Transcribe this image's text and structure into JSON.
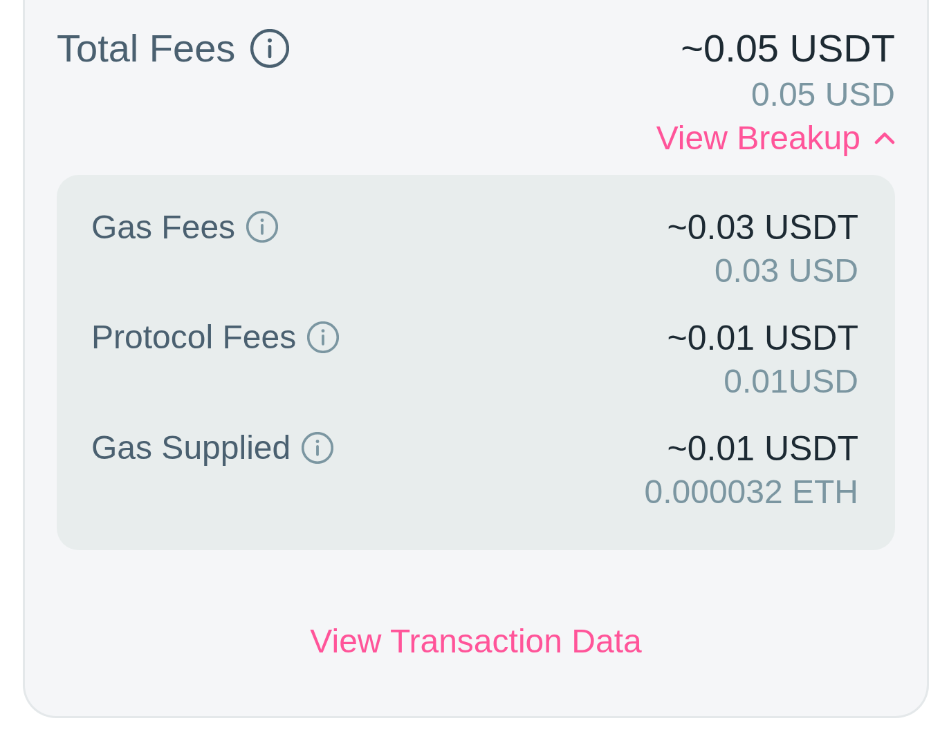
{
  "total": {
    "label": "Total Fees",
    "value": "~0.05 USDT",
    "converted": "0.05 USD"
  },
  "breakup_toggle": {
    "label": "View Breakup",
    "expanded": true
  },
  "breakup": [
    {
      "label": "Gas Fees",
      "value": "~0.03 USDT",
      "converted": "0.03 USD"
    },
    {
      "label": "Protocol Fees",
      "value": "~0.01 USDT",
      "converted": "0.01USD"
    },
    {
      "label": "Gas Supplied",
      "value": "~0.01 USDT",
      "converted": "0.000032 ETH"
    }
  ],
  "footer_link": "View Transaction Data"
}
